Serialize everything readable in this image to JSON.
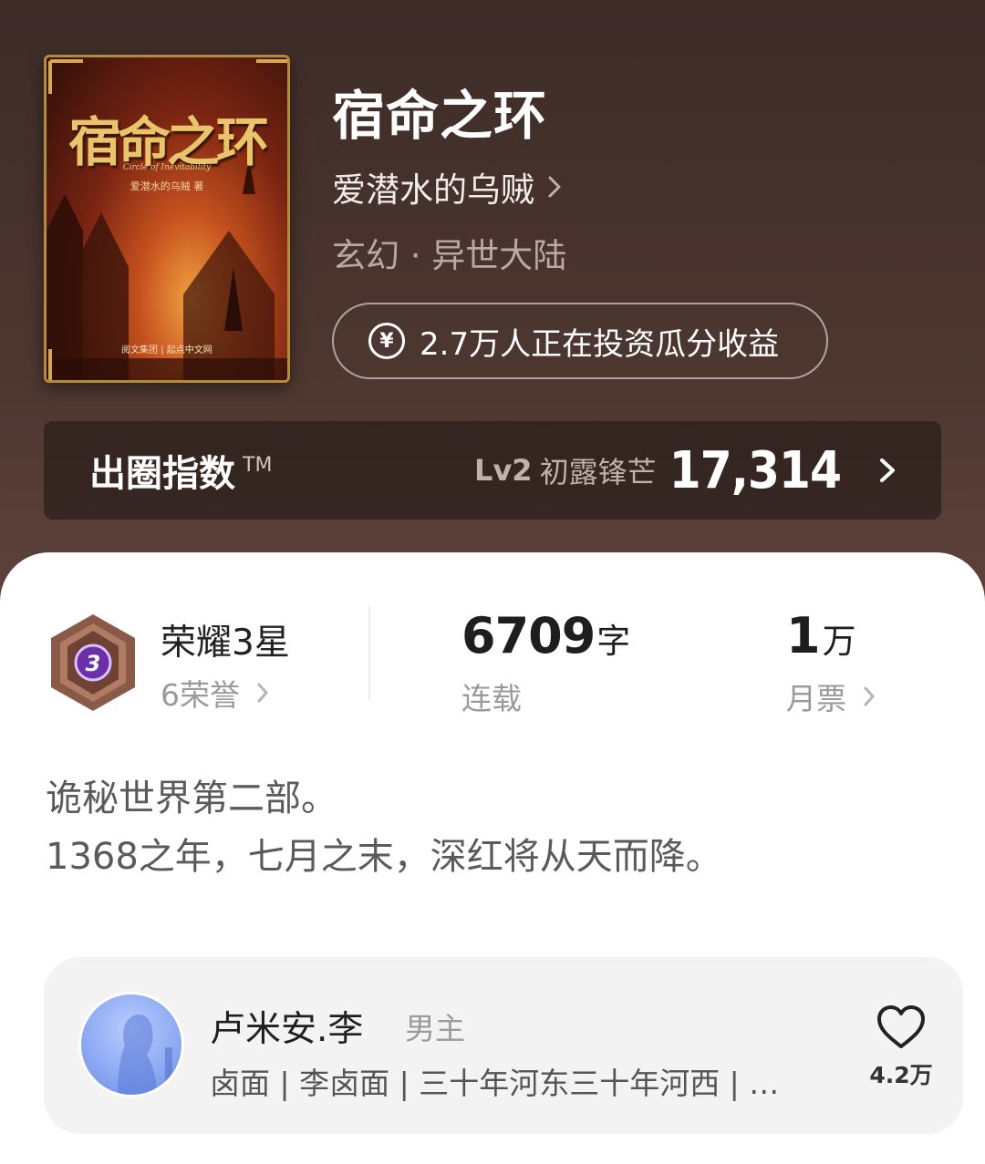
{
  "book": {
    "cover": {
      "title": "宿命之环",
      "subtitle": "Circle of Inevitability",
      "author_line": "爱潜水的乌贼 著",
      "publisher": "阅文集团 | 起点中文网"
    },
    "title": "宿命之环",
    "author": "爱潜水的乌贼",
    "genre": "玄幻 · 异世大陆",
    "invest_text": "2.7万人正在投资瓜分收益"
  },
  "index": {
    "label": "出圈指数",
    "tm": "TM",
    "level": "Lv2",
    "level_name": "初露锋芒",
    "value": "17,314"
  },
  "stats": {
    "badge_number": "3",
    "honor_title": "荣耀3星",
    "honor_count": "6荣誉",
    "words_num": "6709",
    "words_unit": "字",
    "serial_label": "连载",
    "votes_num": "1",
    "votes_unit": "万",
    "votes_label": "月票"
  },
  "synopsis": {
    "line1": "诡秘世界第二部。",
    "line2": "1368之年，七月之末，深红将从天而降。"
  },
  "character": {
    "name": "卢米安.李",
    "role": "男主",
    "tags": "卤面 | 李卤面 | 三十年河东三十年河西 | …",
    "likes": "4.2万"
  },
  "colors": {
    "header_bg": "#4c3630",
    "badge_purple": "#6b2fa8",
    "avatar_blue": "#8fabf3"
  }
}
